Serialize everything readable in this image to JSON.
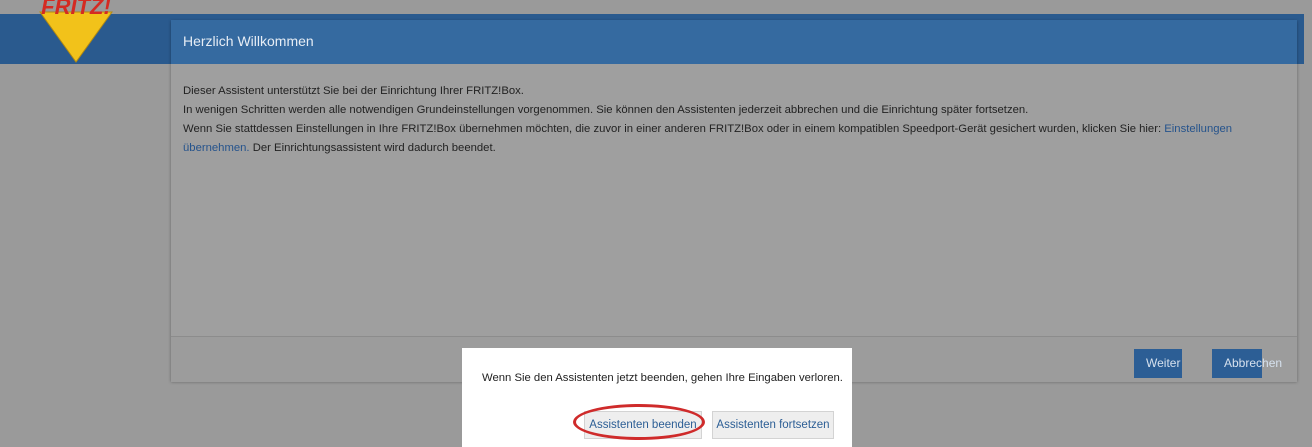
{
  "header": {
    "logo_text": "FRITZ!",
    "title": "Herzlich Willkommen"
  },
  "body": {
    "line1": "Dieser Assistent unterstützt Sie bei der Einrichtung Ihrer FRITZ!Box.",
    "line2": "In wenigen Schritten werden alle notwendigen Grundeinstellungen vorgenommen. Sie können den Assistenten jederzeit abbrechen und die Einrichtung später fortsetzen.",
    "line3_pre": "Wenn Sie stattdessen Einstellungen in Ihre FRITZ!Box übernehmen möchten, die zuvor in einer anderen FRITZ!Box oder in einem kompatiblen Speedport-Gerät gesichert wurden, klicken Sie hier: ",
    "line3_link": "Einstellungen übernehmen.",
    "line3_post": " Der Einrichtungsassistent wird dadurch beendet."
  },
  "footer": {
    "next_label": "Weiter",
    "cancel_label": "Abbrechen"
  },
  "confirm": {
    "message": "Wenn Sie den Assistenten jetzt beenden, gehen Ihre Eingaben verloren.",
    "end_label": "Assistenten beenden",
    "continue_label": "Assistenten fortsetzen"
  },
  "colors": {
    "header_blue": "#356aa0",
    "button_blue": "#2c5e95",
    "highlight_red": "#cf2b2b",
    "logo_red": "#d42a22",
    "logo_yellow": "#f2c21a"
  }
}
